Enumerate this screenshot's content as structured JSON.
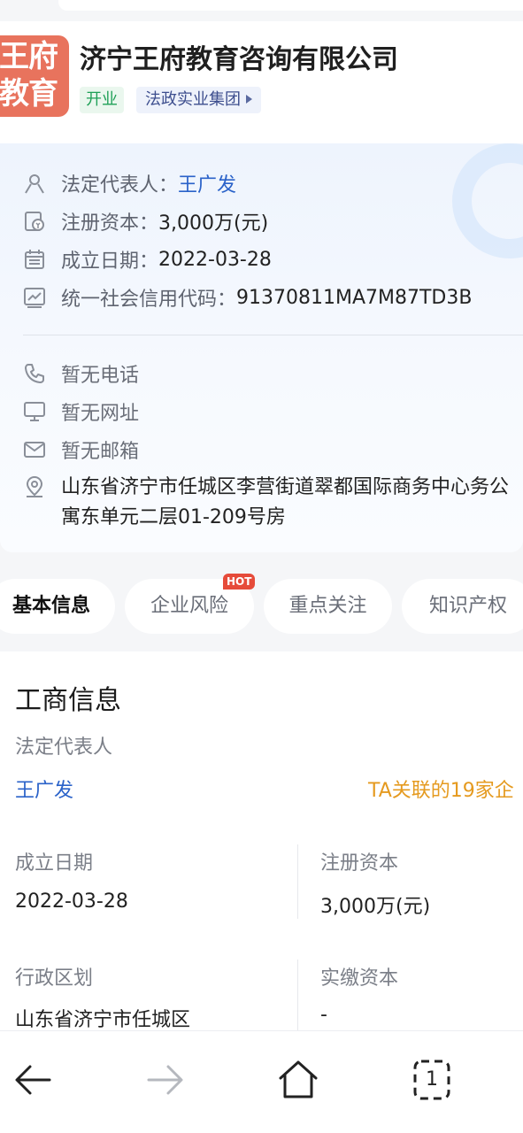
{
  "company": {
    "logo_line1": "王府",
    "logo_line2": "教育",
    "name": "济宁王府教育咨询有限公司",
    "status_tag": "开业",
    "group_tag": "法政实业集团"
  },
  "details": {
    "legal_rep_label": "法定代表人：",
    "legal_rep_value": "王广发",
    "capital_label": "注册资本：",
    "capital_value": "3,000万(元)",
    "founded_label": "成立日期：",
    "founded_value": "2022-03-28",
    "credit_code_label": "统一社会信用代码：",
    "credit_code_value": "91370811MA7M87TD3B",
    "phone": "暂无电话",
    "website": "暂无网址",
    "email": "暂无邮箱",
    "address": "山东省济宁市任城区李营街道翠都国际商务中心务公寓东单元二层01-209号房"
  },
  "tabs": [
    {
      "label": "基本信息"
    },
    {
      "label": "企业风险"
    },
    {
      "label": "重点关注"
    },
    {
      "label": "知识产权"
    }
  ],
  "hot_badge": "HOT",
  "business": {
    "title": "工商信息",
    "legal_rep_label": "法定代表人",
    "legal_rep_value": "王广发",
    "related_companies": "TA关联的19家企",
    "founded_label": "成立日期",
    "founded_value": "2022-03-28",
    "capital_label": "注册资本",
    "capital_value": "3,000万(元)",
    "region_label": "行政区划",
    "region_value": "山东省济宁市任城区",
    "paid_capital_label": "实缴资本",
    "paid_capital_value": "-"
  },
  "nav": {
    "tab_count": "1"
  },
  "colors": {
    "logo_bg": "#e8735d",
    "link": "#2a62c9",
    "orange": "#e59a1f",
    "hot": "#e64b3a"
  }
}
